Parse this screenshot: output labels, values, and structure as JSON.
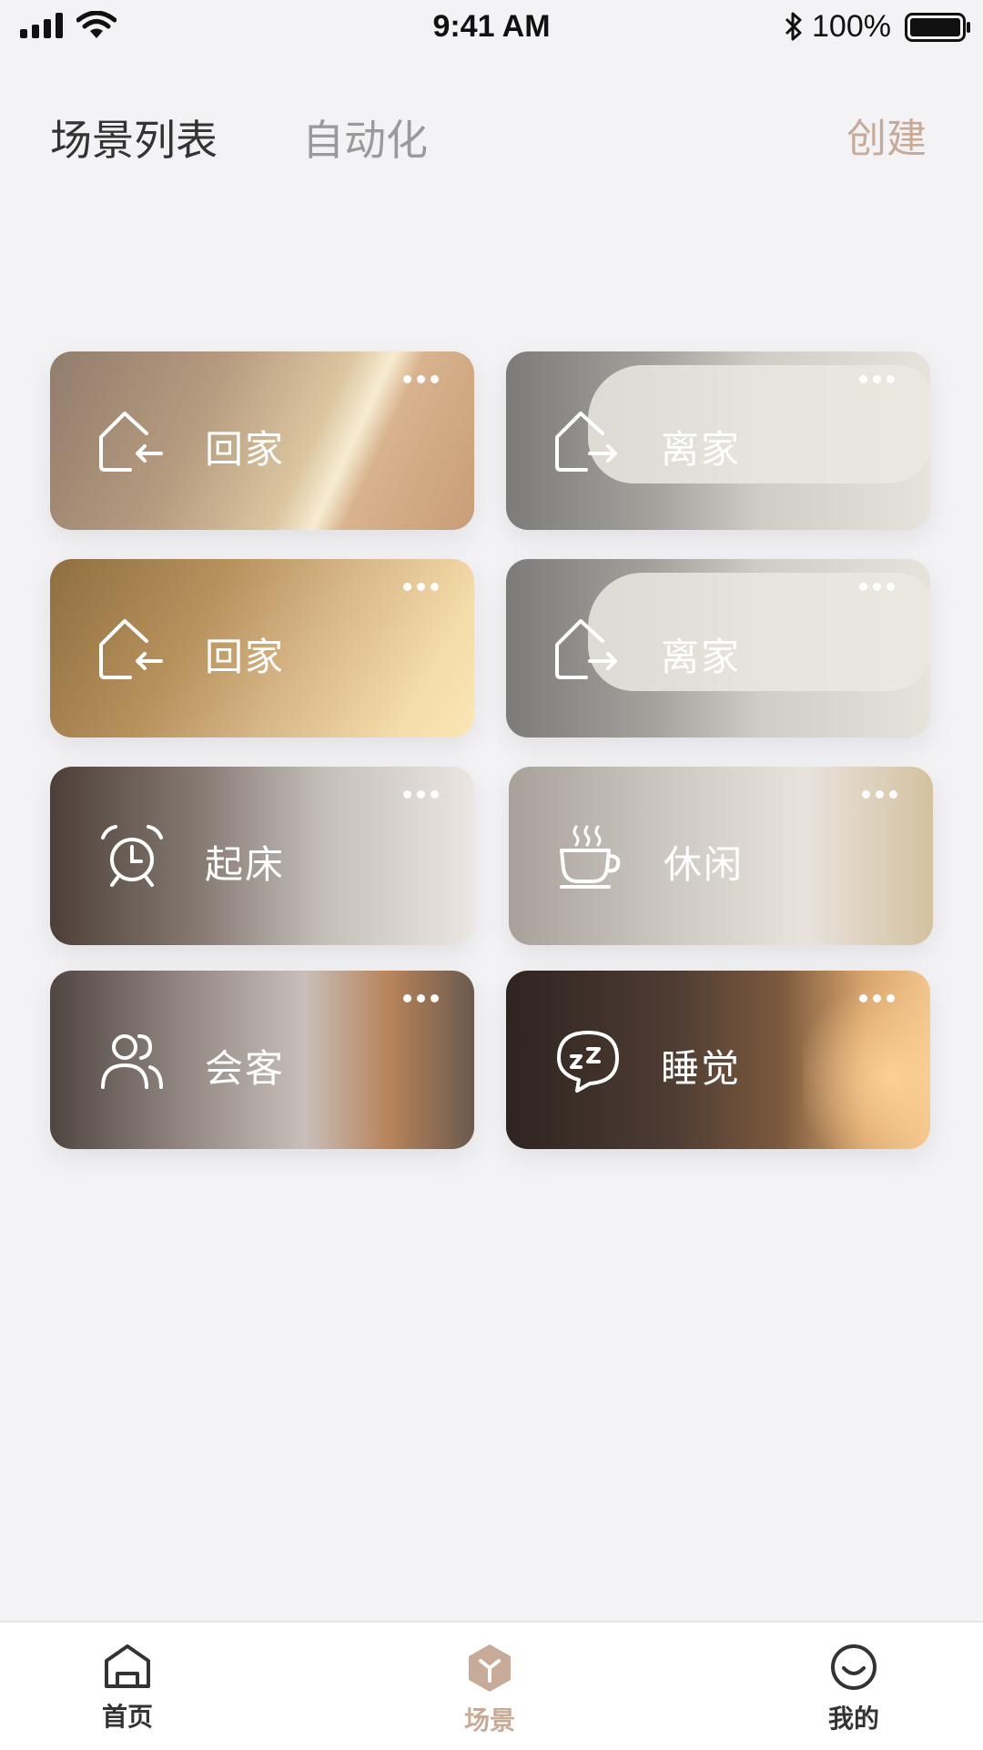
{
  "status_bar": {
    "time": "9:41 AM",
    "battery": "100%"
  },
  "header": {
    "tabs": [
      {
        "label": "场景列表",
        "active": true
      },
      {
        "label": "自动化",
        "active": false
      }
    ],
    "create_label": "创建"
  },
  "scenes": [
    {
      "label": "回家",
      "icon": "home-arrive-icon"
    },
    {
      "label": "离家",
      "icon": "home-leave-icon"
    },
    {
      "label": "回家",
      "icon": "home-arrive-icon"
    },
    {
      "label": "离家",
      "icon": "home-leave-icon"
    },
    {
      "label": "起床",
      "icon": "alarm-clock-icon"
    },
    {
      "label": "休闲",
      "icon": "coffee-cup-icon"
    },
    {
      "label": "会客",
      "icon": "people-icon"
    },
    {
      "label": "睡觉",
      "icon": "sleep-bubble-icon"
    }
  ],
  "tabbar": {
    "items": [
      {
        "label": "首页",
        "icon": "home-icon",
        "active": false
      },
      {
        "label": "场景",
        "icon": "scene-cube-icon",
        "active": true
      },
      {
        "label": "我的",
        "icon": "smile-face-icon",
        "active": false
      }
    ]
  },
  "colors": {
    "accent": "#c7ab98",
    "background": "#f3f3f6"
  }
}
